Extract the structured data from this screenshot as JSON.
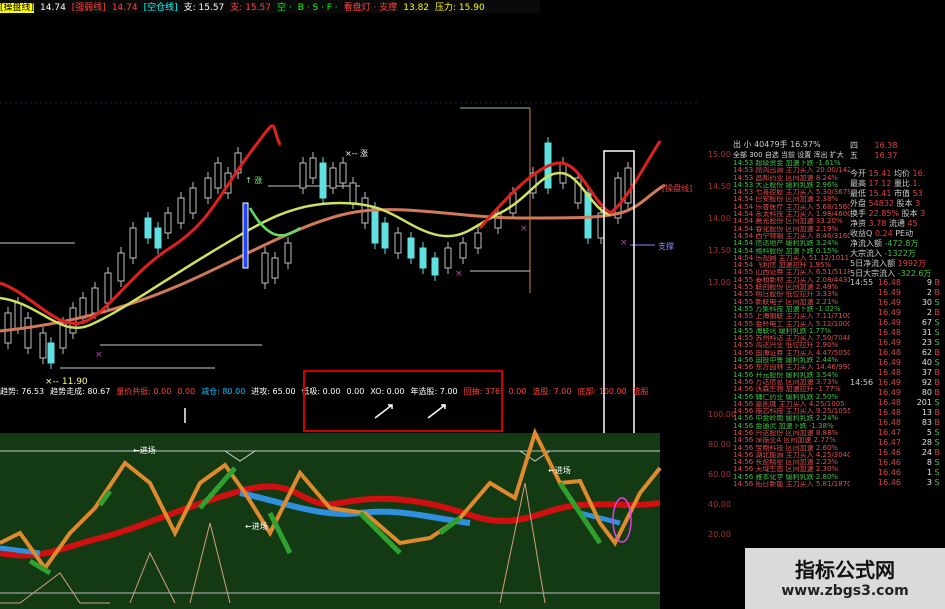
{
  "topbar": {
    "items": [
      {
        "label": "[操盘线]",
        "color": "#ffff00",
        "bg": true
      },
      {
        "label": "14.74",
        "color": "#ffffff"
      },
      {
        "label": "[强弱线]",
        "color": "#ff4040",
        "bg": false
      },
      {
        "label": "14.74",
        "color": "#ff4040"
      },
      {
        "label": "[空仓线]",
        "color": "#00ffff",
        "bg": false
      },
      {
        "label": "支: 15.57",
        "color": "#ffffff"
      },
      {
        "label": "支: 15.57",
        "color": "#ff4040"
      },
      {
        "label": "空 ·",
        "color": "#00ff00"
      },
      {
        "label": "B · S · F ·",
        "color": "#00ff00"
      },
      {
        "label": "看盘灯 · 支撑",
        "color": "#ff4040"
      },
      {
        "label": "13.82",
        "color": "#ffff00"
      },
      {
        "label": "压力: 15.90",
        "color": "#ffff00"
      }
    ]
  },
  "chart_labels": {
    "main_marker_top": "×-- 涨",
    "signal_up": "↑ 涨",
    "low_label": "×-- 11.90",
    "support_label": "支撑",
    "hong_label": "[操盘线]",
    "jin_label_left": "←进场",
    "jin_label_mid": "←进场",
    "jin_label_right": "←进场"
  },
  "indicator_bar": {
    "items": [
      {
        "label": "趋势: 76.53",
        "color": "#ffffff"
      },
      {
        "label": "趋势走成: 80.67",
        "color": "#ffffff"
      },
      {
        "label": "量价共振: 0.00",
        "color": "#ff4040"
      },
      {
        "label": "0.00",
        "color": "#ff4040"
      },
      {
        "label": "减仓: 80.00",
        "color": "#00c0ff"
      },
      {
        "label": "进攻: 65.00",
        "color": "#ffffff"
      },
      {
        "label": "低吸: 0.00",
        "color": "#ffffff"
      },
      {
        "label": "0.00",
        "color": "#ffffff"
      },
      {
        "label": "XO: 0.00",
        "color": "#ffffff"
      },
      {
        "label": "年选股: 7.00",
        "color": "#ffffff"
      },
      {
        "label": "回抽: 376.",
        "color": "#ff4040"
      },
      {
        "label": "0.00",
        "color": "#ff4040"
      },
      {
        "label": "选股: 7.00",
        "color": "#ff4040"
      },
      {
        "label": "底部: 100.00",
        "color": "#ff4040"
      },
      {
        "label": "选股",
        "color": "#ff4040"
      }
    ]
  },
  "price_axis": [
    "15.00",
    "14.50",
    "14.00",
    "13.50",
    "13.00"
  ],
  "osc_axis": [
    "100.00",
    "80.00",
    "60.00",
    "40.00",
    "20.00"
  ],
  "depth": {
    "header": "出 小 40479手 16.97%",
    "tabs": "全部 300 自选 当前 设置 浑出 扩大",
    "rows": [
      "14:53 超级资金 加速下跌 -1.61%",
      "14:53 昂鸿迅源 主力买入 20.00/1421",
      "14:53 昌邦药业 区间加速 8.24%",
      "14:53 大正股份 缓利乳跌 2.96%",
      "14:53 七喜控股 主力买入 5.30/3679",
      "14:54 巴安股份 区间加速 2.38%",
      "14:54 乐普医疗 主力买入 5.68/1560",
      "14:54 永太科技 主力买入 1.98/4600",
      "14:54 晨光股份 区间加速 33.20%",
      "14:54 春化股份 区间加速 2.19%",
      "14:54 西宁特钢 主力买入 8.46/3160",
      "14:54 信达地产 缓利乳跌 3.24%",
      "14:54 格科股份 加速下跌 0.15%",
      "14:54 乐视网 主力买入 51.12/1011",
      "14:54 飞利信 加速拉升 1.95%",
      "14:55 山西证券 主力买入 6.51/5118",
      "14:55 泰和新材 主力买入 2.08/4431",
      "14:55 联创股份 区间加速 2.48%",
      "14:55 明日股份 低位拉升 3.33%",
      "14:55 新联电子 区间加速 2.21%",
      "14:55 万集科技 加速下跌 -1.02%",
      "14:55 上海钢联 主力买入 7.11/7100",
      "14:55 金杯电工 主力买入 5.12/1000",
      "14:55 海联讯 缓利乳跌 1.77%",
      "14:55 苏州科达 主力买入 7.50/7048",
      "14:55 鸿达兴业 低位拉升 2.90%",
      "14:56 国海证券 主力买入 4.47/5050",
      "14:56 国投中鲁 缓利乳跌 2.44%",
      "14:56 东方园林 主力买入 14.46/9900",
      "14:56 开元股份 缓利乳跌 3.54%",
      "14:56 万达信息 区间加速 3.73%",
      "14:56 沃森生物 加速拉升 -1.77%",
      "14:56 辅仁药业 缓利乳跌 2.50%",
      "14:56 嘉凯城 主力买入 4.25/1005",
      "14:56 振芯科技 主力买入 9.25/1055",
      "14:56 中金岭南 缓利乳跌 2.24%",
      "14:56 金通灵 加速下跌 -1.38%",
      "14:56 兴达股份 区间加速 8.88%",
      "14:56 深振业A 区间加速 2.77%",
      "14:56 宝鼎科技 区间加速 2.60%",
      "14:56 湖北能源 主力买入 4.25/3040",
      "14:56 长盈精密 区间加速 2.23%",
      "14:56 天域生态 区间加速 2.30%",
      "14:56 雅本化学 缓利乳跌 2.80%",
      "14:56 拓日新能 主力买入 5.81/1870"
    ]
  },
  "quote": {
    "book": [
      {
        "lv": "四",
        "price": "16.38"
      },
      {
        "lv": "五",
        "price": "16.37"
      }
    ],
    "stats": [
      {
        "k": "今开",
        "v": "15.41",
        "k2": "均价",
        "v2": "16."
      },
      {
        "k": "最高",
        "v": "17.12",
        "k2": "量比",
        "v2": "1."
      },
      {
        "k": "最低",
        "v": "15.41",
        "k2": "市值",
        "v2": "53"
      },
      {
        "k": "外盘",
        "v": "54832",
        "k2": "股本",
        "v2": "3"
      },
      {
        "k": "换手",
        "v": "22.85%",
        "k2": "股本",
        "v2": "3"
      },
      {
        "k": "净资",
        "v": "3.78",
        "k2": "流通",
        "v2": "45"
      },
      {
        "k": "收益Q",
        "v": "0.24",
        "k2": "PE动",
        "v2": ""
      }
    ],
    "flows": [
      {
        "k": "净流入额",
        "v": "-472.8万"
      },
      {
        "k": "大宗流入",
        "v": "-1322万"
      },
      {
        "k": "5日净流入额",
        "v": "1992万"
      },
      {
        "k": "5日大宗流入",
        "v": "-322.6万"
      }
    ],
    "ticks": [
      {
        "t": "14:55",
        "p": "16.48",
        "v": "9",
        "s": "B"
      },
      {
        "t": "",
        "p": "16.49",
        "v": "2",
        "s": "B"
      },
      {
        "t": "",
        "p": "16.49",
        "v": "30",
        "s": "S"
      },
      {
        "t": "",
        "p": "16.49",
        "v": "2",
        "s": "B"
      },
      {
        "t": "",
        "p": "16.49",
        "v": "67",
        "s": "S"
      },
      {
        "t": "",
        "p": "16.48",
        "v": "31",
        "s": "S"
      },
      {
        "t": "",
        "p": "16.49",
        "v": "23",
        "s": "S"
      },
      {
        "t": "",
        "p": "16.48",
        "v": "62",
        "s": "B"
      },
      {
        "t": "",
        "p": "16.49",
        "v": "40",
        "s": "S"
      },
      {
        "t": "",
        "p": "16.48",
        "v": "37",
        "s": "B"
      },
      {
        "t": "14:56",
        "p": "16.49",
        "v": "92",
        "s": "B"
      },
      {
        "t": "",
        "p": "16.49",
        "v": "80",
        "s": "B"
      },
      {
        "t": "",
        "p": "16.48",
        "v": "201",
        "s": "S"
      },
      {
        "t": "",
        "p": "16.48",
        "v": "13",
        "s": "B"
      },
      {
        "t": "",
        "p": "16.48",
        "v": "83",
        "s": "B"
      },
      {
        "t": "",
        "p": "16.47",
        "v": "5",
        "s": "S"
      },
      {
        "t": "",
        "p": "16.47",
        "v": "28",
        "s": "S"
      },
      {
        "t": "",
        "p": "16.46",
        "v": "24",
        "s": "B"
      },
      {
        "t": "",
        "p": "16.46",
        "v": "8",
        "s": "S"
      },
      {
        "t": "",
        "p": "16.46",
        "v": "1",
        "s": "S"
      },
      {
        "t": "",
        "p": "16.46",
        "v": "3",
        "s": "S"
      }
    ]
  },
  "watermark": {
    "title": "指标公式网",
    "url": "www.zbgs3.com"
  }
}
